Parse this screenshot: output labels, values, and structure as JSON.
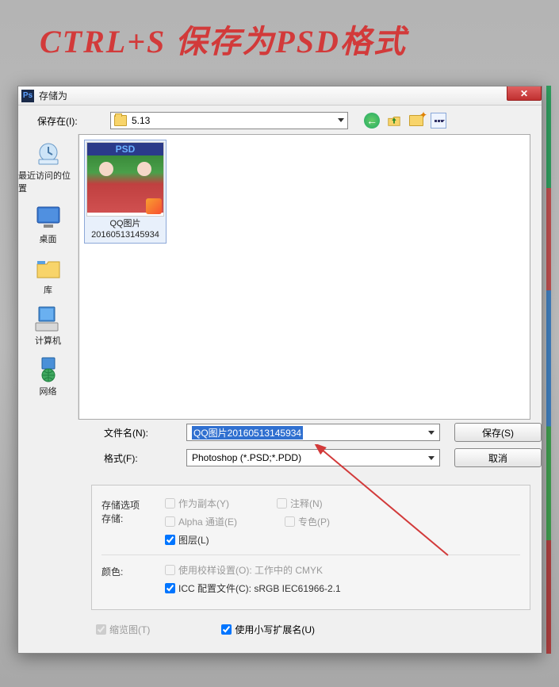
{
  "annotation": "CTRL+S 保存为PSD格式",
  "dialog": {
    "title": "存储为",
    "location_label": "保存在(I):",
    "location_value": "5.13",
    "places": {
      "recent": "最近访问的位置",
      "desktop": "桌面",
      "library": "库",
      "computer": "计算机",
      "network": "网络"
    },
    "thumb": {
      "badge": "PSD",
      "caption_line1": "QQ图片",
      "caption_line2": "20160513145934"
    },
    "filename_label": "文件名(N):",
    "filename_value": "QQ图片20160513145934",
    "format_label": "格式(F):",
    "format_value": "Photoshop (*.PSD;*.PDD)",
    "save_btn": "保存(S)",
    "cancel_btn": "取消",
    "options_title": "存储选项",
    "options_store": "存储:",
    "as_copy": "作为副本(Y)",
    "notes": "注释(N)",
    "alpha": "Alpha 通道(E)",
    "spot": "专色(P)",
    "layers": "图层(L)",
    "color_label": "颜色:",
    "proof": "使用校样设置(O): 工作中的 CMYK",
    "icc": "ICC 配置文件(C): sRGB IEC61966-2.1",
    "thumbnail": "缩览图(T)",
    "lowercase_ext": "使用小写扩展名(U)"
  }
}
